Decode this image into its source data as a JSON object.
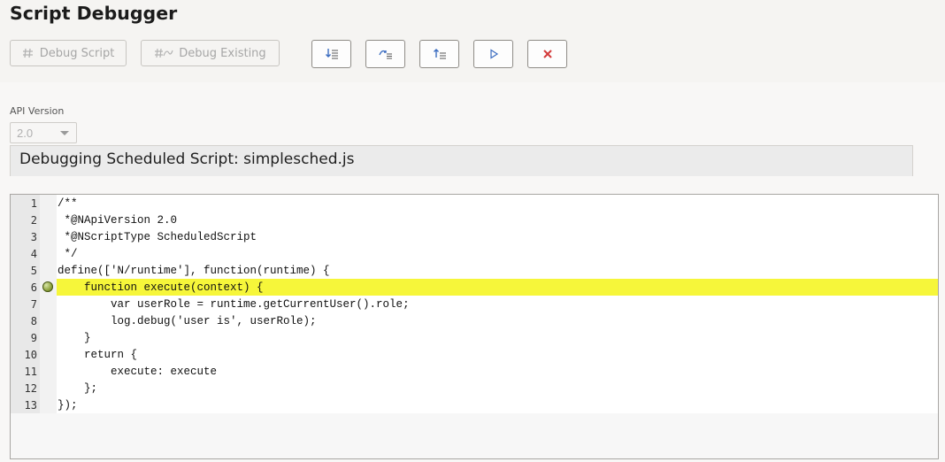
{
  "page": {
    "title": "Script Debugger"
  },
  "toolbar": {
    "debug_script_label": "Debug Script",
    "debug_existing_label": "Debug Existing",
    "step_buttons": [
      {
        "icon": "step-into-icon"
      },
      {
        "icon": "step-over-icon"
      },
      {
        "icon": "step-out-icon"
      },
      {
        "icon": "play-icon"
      },
      {
        "icon": "stop-icon"
      }
    ]
  },
  "api_version": {
    "label": "API Version",
    "value": "2.0"
  },
  "banner": {
    "text": "Debugging Scheduled Script: simplesched.js"
  },
  "editor": {
    "current_line": 6,
    "highlight_color": "#f6f63a",
    "lines": [
      {
        "n": "1",
        "text": "/**"
      },
      {
        "n": "2",
        "text": " *@NApiVersion 2.0"
      },
      {
        "n": "3",
        "text": " *@NScriptType ScheduledScript"
      },
      {
        "n": "4",
        "text": " */"
      },
      {
        "n": "5",
        "text": "define(['N/runtime'], function(runtime) {"
      },
      {
        "n": "6",
        "text": "    function execute(context) {"
      },
      {
        "n": "7",
        "text": "        var userRole = runtime.getCurrentUser().role;"
      },
      {
        "n": "8",
        "text": "        log.debug('user is', userRole);"
      },
      {
        "n": "9",
        "text": "    }"
      },
      {
        "n": "10",
        "text": "    return {"
      },
      {
        "n": "11",
        "text": "        execute: execute"
      },
      {
        "n": "12",
        "text": "    };"
      },
      {
        "n": "13",
        "text": "});"
      }
    ]
  }
}
